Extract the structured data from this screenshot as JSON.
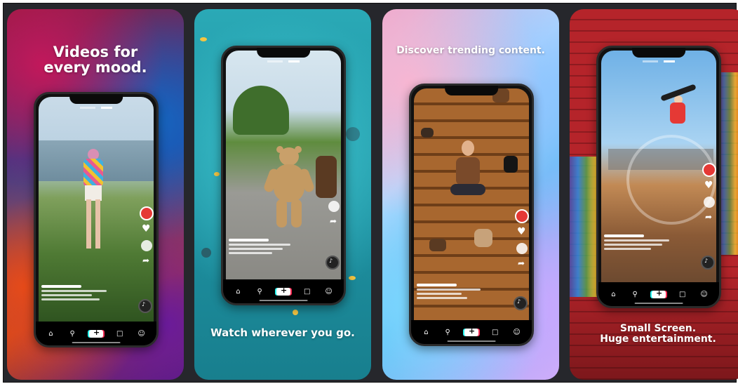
{
  "cards": [
    {
      "caption_lines": [
        "Videos for",
        "every mood."
      ]
    },
    {
      "caption_lines": [
        "Watch wherever you go."
      ]
    },
    {
      "caption_lines": [
        "Discover trending content."
      ]
    },
    {
      "caption_lines": [
        "Small Screen.",
        "Huge entertainment."
      ]
    }
  ]
}
